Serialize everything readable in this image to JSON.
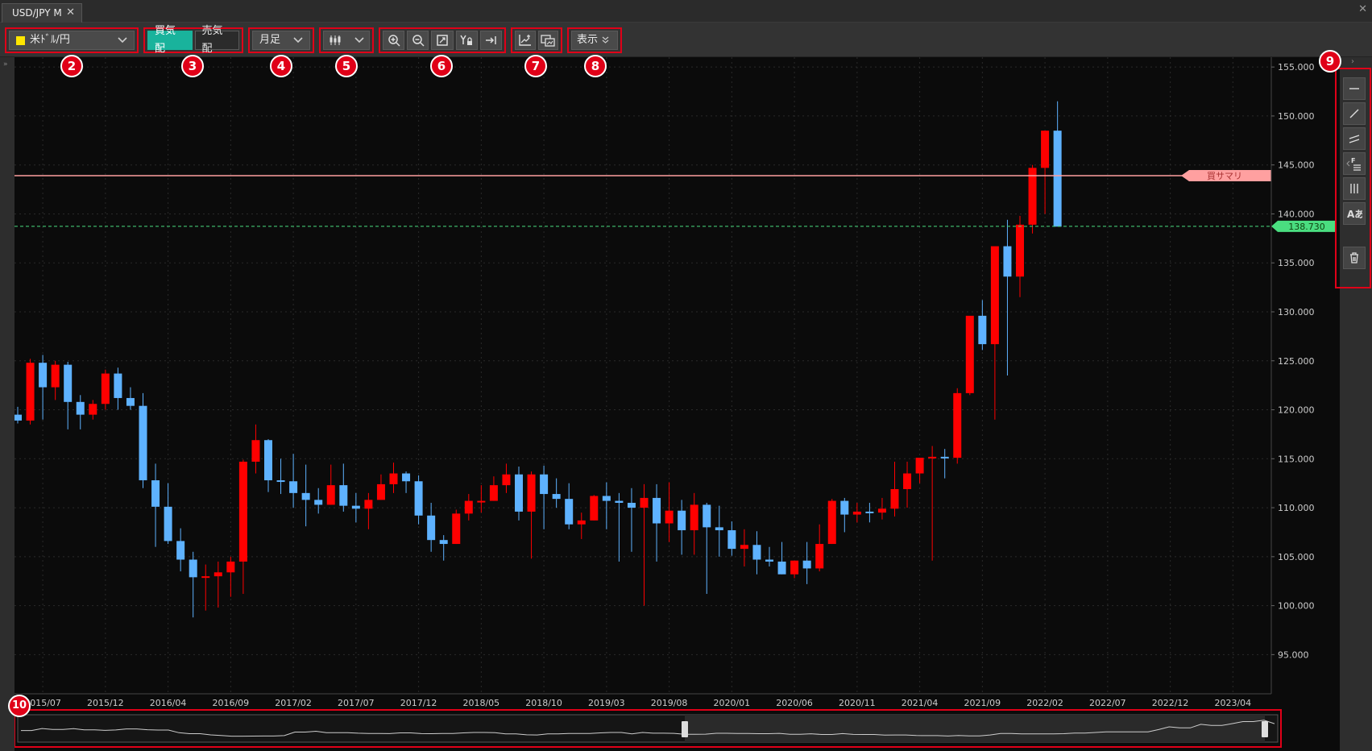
{
  "tab": {
    "title": "USD/JPY M",
    "close": "✕"
  },
  "toolbar": {
    "symbol": {
      "label": "米ﾄﾞﾙ/円",
      "color": "#ffe600"
    },
    "bid_label": "買気配",
    "ask_label": "売気配",
    "period": "月足",
    "view_label": "表示"
  },
  "badges": [
    "2",
    "3",
    "4",
    "5",
    "6",
    "7",
    "8",
    "9",
    "10"
  ],
  "price_axis": {
    "ticks": [
      "95.000",
      "100.000",
      "105.000",
      "110.000",
      "115.000",
      "120.000",
      "125.000",
      "130.000",
      "135.000",
      "140.000",
      "145.000",
      "150.000",
      "155.000"
    ],
    "current_price": "138.730",
    "current_color": "#4ade80",
    "position_label": "買サマリ",
    "position_color": "#ffa0a0"
  },
  "time_axis": {
    "labels": [
      "2015/07",
      "2015/12",
      "2016/04",
      "2016/09",
      "2017/02",
      "2017/07",
      "2017/12",
      "2018/05",
      "2018/10",
      "2019/03",
      "2019/08",
      "2020/01",
      "2020/06",
      "2020/11",
      "2021/04",
      "2021/09",
      "2022/02",
      "2022/07",
      "2022/12",
      "2023/04"
    ]
  },
  "colors": {
    "up": "#ff0000",
    "down": "#5eb2ff",
    "accent": "#19b39c",
    "highlight": "#e00018"
  },
  "chart_data": {
    "type": "candlestick",
    "symbol": "USD/JPY",
    "timeframe": "M",
    "ylim": [
      91,
      156
    ],
    "candles": [
      [
        119.5,
        120.3,
        118.6,
        118.9
      ],
      [
        118.9,
        125.2,
        118.5,
        124.8
      ],
      [
        124.8,
        125.6,
        119,
        122.3
      ],
      [
        122.3,
        125,
        121,
        124.6
      ],
      [
        124.6,
        124.9,
        118,
        120.8
      ],
      [
        120.8,
        121.5,
        118,
        119.5
      ],
      [
        119.5,
        121,
        119,
        120.6
      ],
      [
        120.6,
        124.1,
        120,
        123.7
      ],
      [
        123.7,
        124.3,
        120,
        121.2
      ],
      [
        121.2,
        122.3,
        120,
        120.4
      ],
      [
        120.4,
        121.7,
        112,
        112.8
      ],
      [
        112.8,
        114.5,
        106,
        110.1
      ],
      [
        110.1,
        112.5,
        106.3,
        106.6
      ],
      [
        106.6,
        107.9,
        103.5,
        104.7
      ],
      [
        104.7,
        105.5,
        98.8,
        102.9
      ],
      [
        102.9,
        104.2,
        99.5,
        103.0
      ],
      [
        103.0,
        104.5,
        99.8,
        103.4
      ],
      [
        103.4,
        105.0,
        100.9,
        104.5
      ],
      [
        104.5,
        114.9,
        101.2,
        114.7
      ],
      [
        114.7,
        118.5,
        113.5,
        116.9
      ],
      [
        116.9,
        117.0,
        111.6,
        112.8
      ],
      [
        112.8,
        115.0,
        111.4,
        112.7
      ],
      [
        112.7,
        115.5,
        110.0,
        111.5
      ],
      [
        111.5,
        114.4,
        108.1,
        110.8
      ],
      [
        110.8,
        112.0,
        109.4,
        110.3
      ],
      [
        110.3,
        114.4,
        110.3,
        112.3
      ],
      [
        112.3,
        114.5,
        109.6,
        110.2
      ],
      [
        110.2,
        111.5,
        108.5,
        109.9
      ],
      [
        109.9,
        111.5,
        107.8,
        110.8
      ],
      [
        110.8,
        113.4,
        110.8,
        112.4
      ],
      [
        112.4,
        114.6,
        111.5,
        113.5
      ],
      [
        113.5,
        113.7,
        111.5,
        112.7
      ],
      [
        112.7,
        113.3,
        108.3,
        109.2
      ],
      [
        109.2,
        110.5,
        105.5,
        106.7
      ],
      [
        106.7,
        107.2,
        104.6,
        106.3
      ],
      [
        106.3,
        109.8,
        106.3,
        109.4
      ],
      [
        109.4,
        111.4,
        108.7,
        110.7
      ],
      [
        110.7,
        112.3,
        109.5,
        110.7
      ],
      [
        110.7,
        113.2,
        110.7,
        112.3
      ],
      [
        112.3,
        114.5,
        111.5,
        113.4
      ],
      [
        113.4,
        114.2,
        108.7,
        109.6
      ],
      [
        109.6,
        113.7,
        104.8,
        113.4
      ],
      [
        113.4,
        114.3,
        107.8,
        111.4
      ],
      [
        111.4,
        113.0,
        110.0,
        110.9
      ],
      [
        110.9,
        112.5,
        107.8,
        108.3
      ],
      [
        108.3,
        109.5,
        106.8,
        108.7
      ],
      [
        108.7,
        111.3,
        108.7,
        111.2
      ],
      [
        111.2,
        112.6,
        107.8,
        110.7
      ],
      [
        110.7,
        111.5,
        104.5,
        110.5
      ],
      [
        110.5,
        112.0,
        105.5,
        110.0
      ],
      [
        110.0,
        112.4,
        100.0,
        111.0
      ],
      [
        111.0,
        112.4,
        104.5,
        108.4
      ],
      [
        108.4,
        112.6,
        106.5,
        109.7
      ],
      [
        109.7,
        110.8,
        105.2,
        107.7
      ],
      [
        107.7,
        111.5,
        105.2,
        110.3
      ],
      [
        110.3,
        110.5,
        101.2,
        108.0
      ],
      [
        108.0,
        110.2,
        105.0,
        107.7
      ],
      [
        107.7,
        108.6,
        105.1,
        105.8
      ],
      [
        105.8,
        107.8,
        104.0,
        106.2
      ],
      [
        106.2,
        107.6,
        103.2,
        104.7
      ],
      [
        104.7,
        106.0,
        104.0,
        104.5
      ],
      [
        104.5,
        106.5,
        103.2,
        103.2
      ],
      [
        103.2,
        104.5,
        102.8,
        104.6
      ],
      [
        104.6,
        106.5,
        102.2,
        103.8
      ],
      [
        103.8,
        108.3,
        103.5,
        106.3
      ],
      [
        106.3,
        110.9,
        106.3,
        110.7
      ],
      [
        110.7,
        111.0,
        107.5,
        109.3
      ],
      [
        109.3,
        110.5,
        108.5,
        109.6
      ],
      [
        109.6,
        110.5,
        108.5,
        109.5
      ],
      [
        109.5,
        111.0,
        108.8,
        109.9
      ],
      [
        109.9,
        114.7,
        109.1,
        111.9
      ],
      [
        111.9,
        114.7,
        110.0,
        113.5
      ],
      [
        113.5,
        114.9,
        112.5,
        115.1
      ],
      [
        115.1,
        116.3,
        104.6,
        115.2
      ],
      [
        115.2,
        116.0,
        113.0,
        115.1
      ],
      [
        115.1,
        122.2,
        114.5,
        121.7
      ],
      [
        121.7,
        126.1,
        121.5,
        129.6
      ],
      [
        129.6,
        131.2,
        126.1,
        126.7
      ],
      [
        126.7,
        135.4,
        119.0,
        136.7
      ],
      [
        136.7,
        139.4,
        123.5,
        133.6
      ],
      [
        133.6,
        139.8,
        131.5,
        138.9
      ],
      [
        138.9,
        145.0,
        138.0,
        144.7
      ],
      [
        144.7,
        147.8,
        140.0,
        148.5
      ],
      [
        148.5,
        151.5,
        145.0,
        138.7
      ]
    ]
  }
}
